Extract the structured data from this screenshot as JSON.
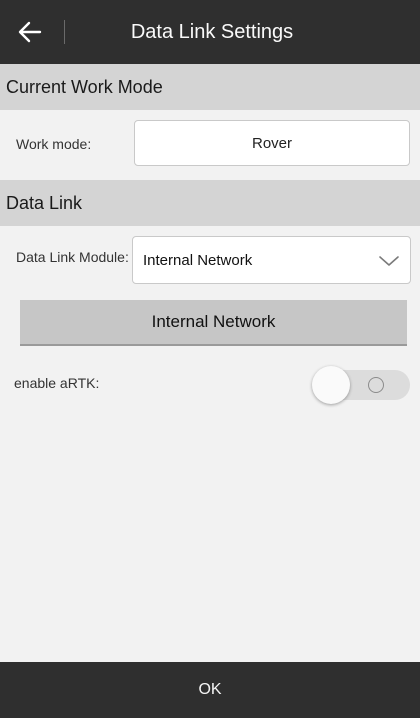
{
  "header": {
    "back_icon": "arrow-left-icon",
    "title": "Data Link Settings"
  },
  "sections": {
    "work_mode_title": "Current Work Mode",
    "data_link_title": "Data Link"
  },
  "work_mode": {
    "label": "Work mode:",
    "value": "Rover"
  },
  "data_link": {
    "module_label": "Data Link Module:",
    "module_value": "Internal Network",
    "module_icon": "chevron-down-icon",
    "module_button_label": "Internal Network"
  },
  "artk": {
    "label": "enable aRTK:",
    "enabled": false
  },
  "footer": {
    "ok_label": "OK"
  },
  "colors": {
    "topbar": "#2f2f2f",
    "section_header": "#d4d4d4",
    "background": "#f2f2f2",
    "button": "#c6c6c6"
  }
}
